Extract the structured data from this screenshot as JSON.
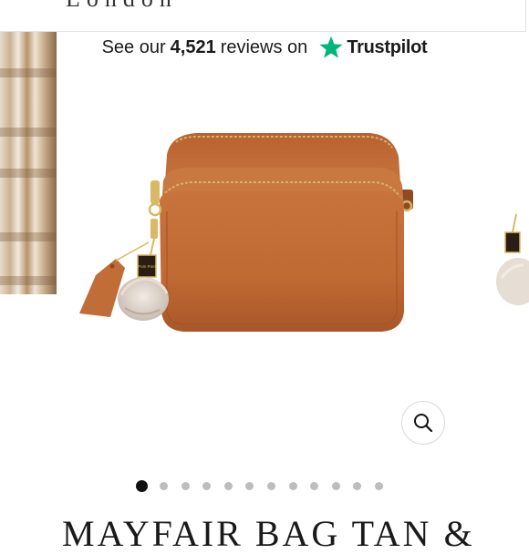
{
  "header": {
    "logo_text": "London"
  },
  "reviews": {
    "prefix": "See our",
    "count": "4,521",
    "middle": "reviews on",
    "brand": "Trustpilot",
    "star_icon": "trustpilot-star-icon",
    "star_color": "#00b67a"
  },
  "product": {
    "title": "MAYFAIR BAG TAN &",
    "bag_color": "#c26a34",
    "tag_text": "Pom Pom"
  },
  "gallery": {
    "slide_count": 12,
    "active_index": 0
  },
  "zoom": {
    "icon": "magnifier-icon"
  }
}
